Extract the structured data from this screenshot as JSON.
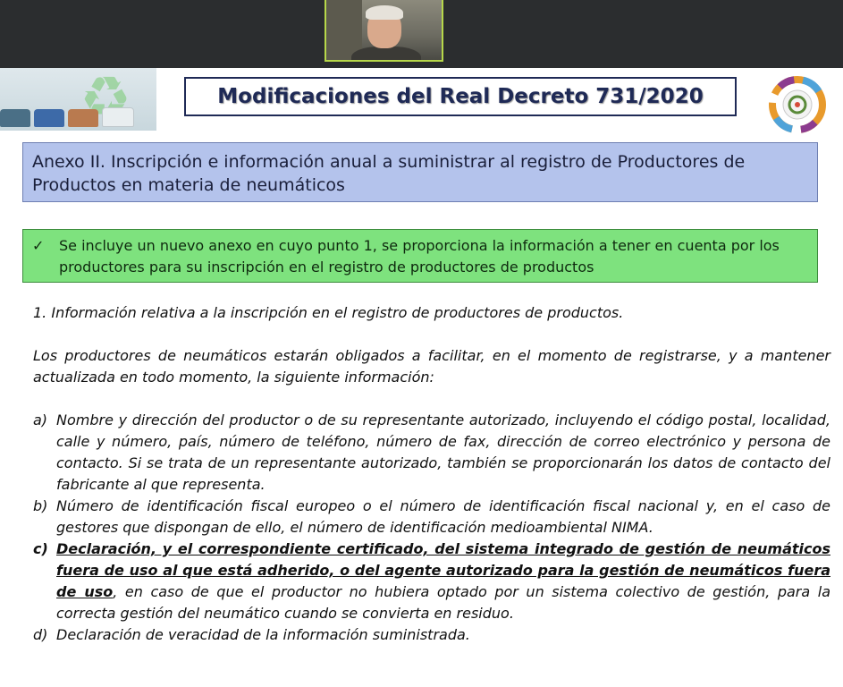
{
  "slide": {
    "title": "Modificaciones del Real Decreto 731/2020",
    "annex_heading": "Anexo II. Inscripción e información anual a suministrar al registro de Productores de Productos en materia de neumáticos",
    "highlight": {
      "check": "✓",
      "text": "Se incluye un nuevo anexo en cuyo punto 1, se proporciona la información a tener en cuenta por los productores para su inscripción en el registro de productores de productos"
    },
    "section_title": "1. Información relativa a la inscripción en el registro de productores de productos.",
    "intro": "Los productores de neumáticos estarán obligados a facilitar, en el momento de registrarse, y a mantener actualizada en todo momento, la siguiente información:",
    "items": [
      {
        "label": "a)",
        "text": "Nombre y dirección del productor o de su representante autorizado, incluyendo el código postal, localidad, calle y número, país, número de teléfono, número de fax, dirección de correo electrónico y persona de contacto. Si se trata de un representante autorizado, también se proporcionarán los datos de contacto del fabricante al que representa."
      },
      {
        "label": "b)",
        "text": "Número de identificación fiscal europeo o el número de identificación fiscal nacional y, en el caso de gestores que dispongan de ello, el número de identificación medioambiental NIMA."
      },
      {
        "label": "c)",
        "bold_text": "Declaración, y el correspondiente certificado, del sistema integrado de gestión de neumáticos fuera de uso al que está adherido, o del agente autorizado para la gestión de neumáticos fuera de uso",
        "text": ", en caso de que el productor no hubiera optado por un sistema colectivo de gestión, para la correcta gestión del neumático cuando se convierta en residuo."
      },
      {
        "label": "d)",
        "text": "Declaración de veracidad de la información suministrada."
      }
    ]
  },
  "icons": {
    "recycle": "♻",
    "left_logo": "recycle-bins-logo",
    "right_logo": "circular-economy-logo"
  },
  "colors": {
    "title_text": "#1f2a56",
    "annex_bg": "#b4c3ec",
    "highlight_bg": "#7ee27e",
    "topbar": "#2b2d2f",
    "webcam_border": "#b7d84a"
  }
}
